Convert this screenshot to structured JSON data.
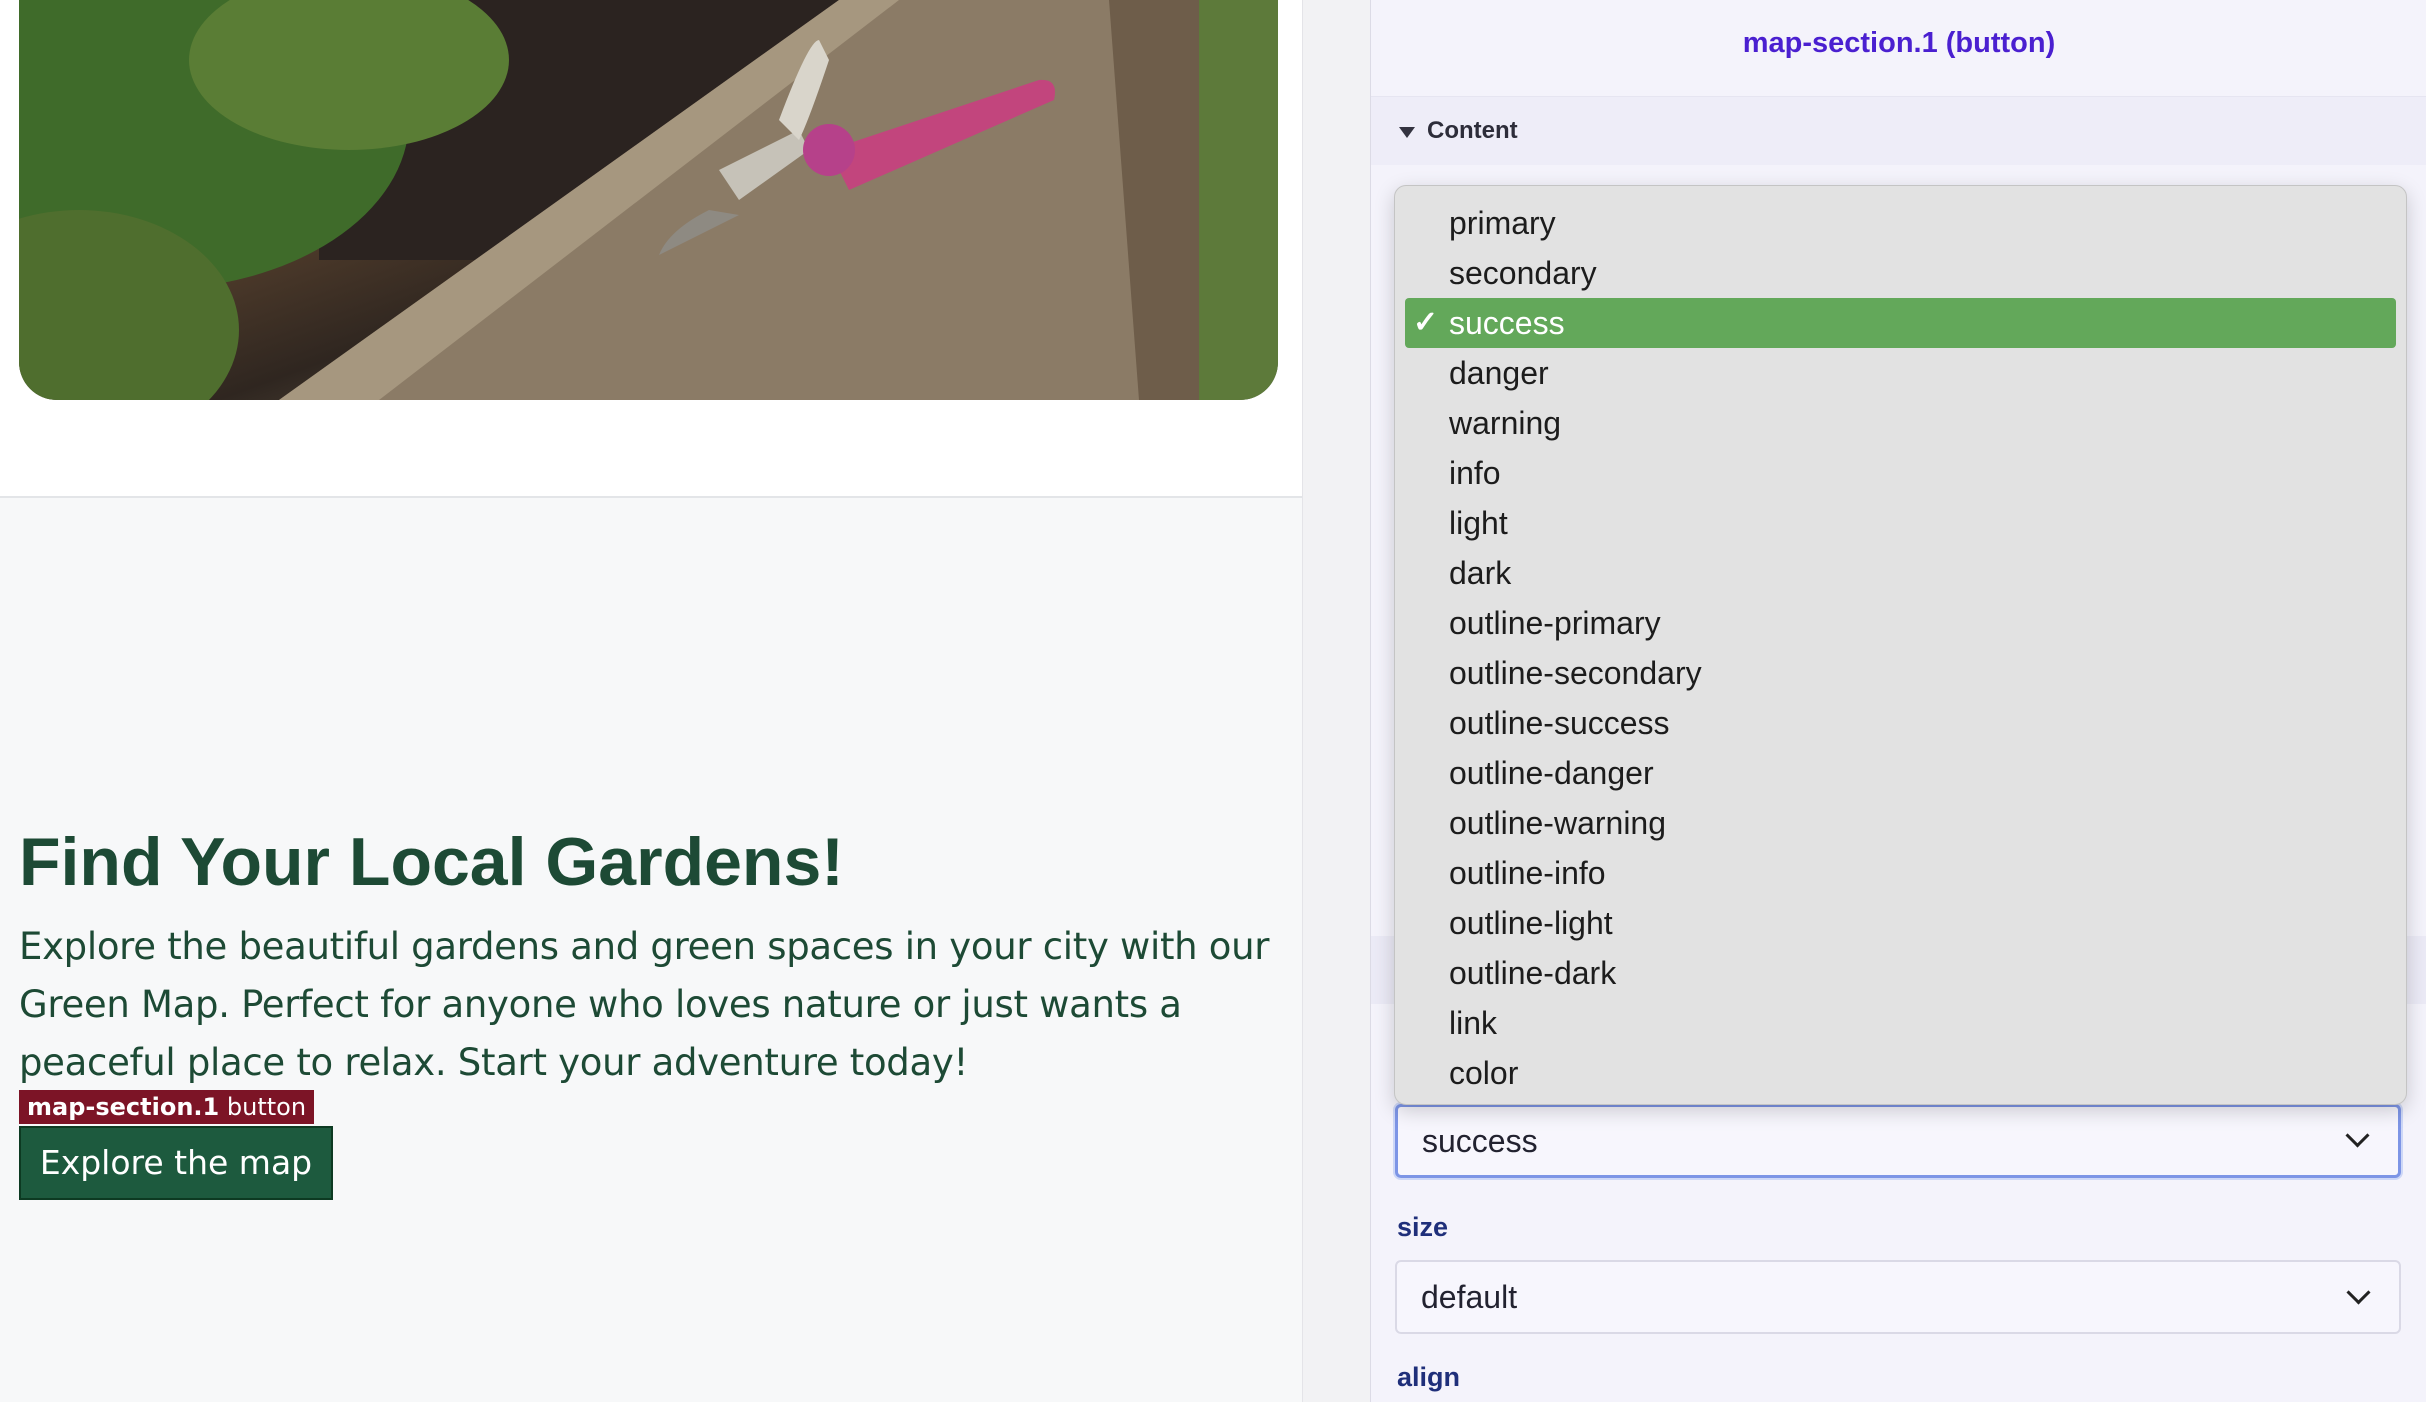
{
  "inspector": {
    "title": "map-section.1 (button)",
    "section_content": "Content",
    "variant": {
      "value": "success",
      "options": [
        "primary",
        "secondary",
        "success",
        "danger",
        "warning",
        "info",
        "light",
        "dark",
        "outline-primary",
        "outline-secondary",
        "outline-success",
        "outline-danger",
        "outline-warning",
        "outline-info",
        "outline-light",
        "outline-dark",
        "link",
        "color"
      ],
      "selected_index": 2
    },
    "size": {
      "label": "size",
      "value": "default"
    },
    "align": {
      "label": "align"
    }
  },
  "preview": {
    "headline": "Find Your Local Gardens!",
    "body": "Explore the beautiful gardens and green spaces in your city with our Green Map. Perfect for anyone who loves nature or just wants a peaceful place to relax. Start your adventure today!",
    "selection_tag": {
      "id": "map-section.1",
      "type": "button"
    },
    "cta_label": "Explore the map"
  },
  "colors": {
    "accent": "#4a1fd0",
    "button_bg": "#1d5a3e",
    "heading": "#1d4a35",
    "selected_option": "#63a85a",
    "tag_bg": "#7c1426"
  }
}
